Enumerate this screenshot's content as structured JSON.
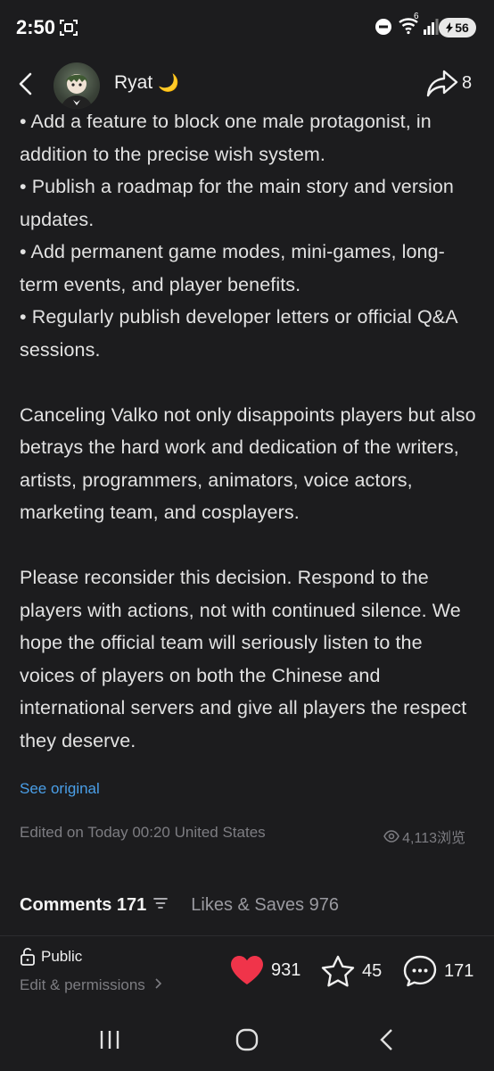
{
  "status_bar": {
    "time": "2:50",
    "battery": "56",
    "wifi_badge": "6",
    "icons": [
      "screenshot-icon",
      "do-not-disturb-icon",
      "wifi-icon",
      "signal-icon",
      "battery-icon"
    ]
  },
  "header": {
    "user_name": "Ryat",
    "moon_glyph": "🌙",
    "share_count": "8"
  },
  "article": {
    "clipped_line": "• Add a feature to block one male protagonist, in",
    "paragraphs": [
      "addition to the precise wish system.",
      "• Publish a roadmap for the main story and version updates.",
      "• Add permanent game modes, mini-games, long-term events, and player benefits.",
      "• Regularly publish developer letters or official Q&A sessions."
    ],
    "paragraph_2": "Canceling Valko not only disappoints players but also betrays the hard work and dedication of the writers, artists, programmers, animators, voice actors, marketing team, and cosplayers.",
    "paragraph_3": "Please reconsider this decision. Respond to the players with actions, not with continued silence. We hope the official team will seriously listen to the voices of players on both the Chinese and international servers and give all players the respect they deserve."
  },
  "meta": {
    "see_original": "See original",
    "edited": "Edited on Today 00:20 United States",
    "views": "4,113浏览"
  },
  "tabs": {
    "comments": "Comments 171",
    "likes_saves": "Likes & Saves 976"
  },
  "bottom_bar": {
    "privacy": "Public",
    "permissions": "Edit & permissions",
    "likes": "931",
    "stars": "45",
    "comments": "171"
  },
  "colors": {
    "background": "#1c1c1e",
    "link": "#4a9fe8",
    "like_red": "#f0344a",
    "muted": "#7d7d82"
  }
}
